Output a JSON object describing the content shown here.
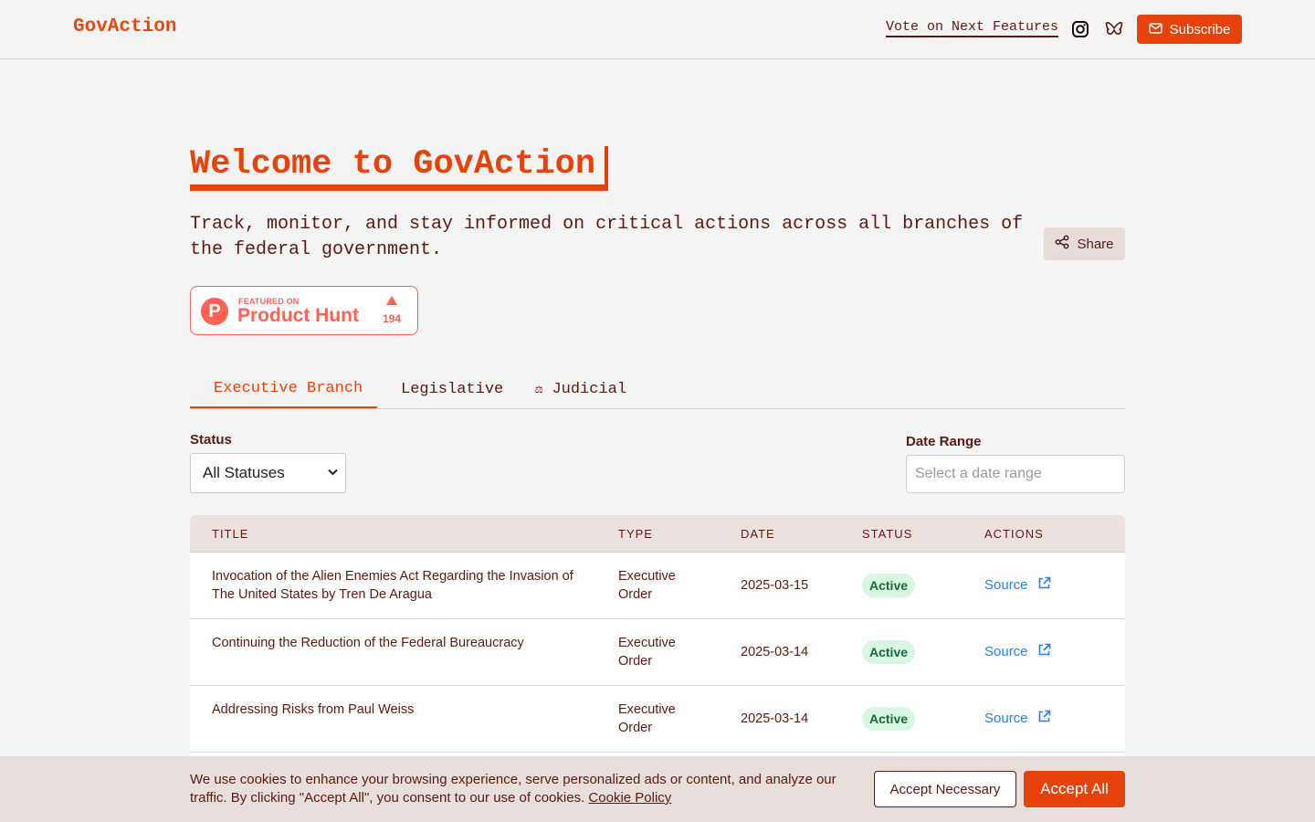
{
  "header": {
    "logo": "GovAction",
    "vote_link": "Vote on Next Features",
    "instagram_icon": "instagram-icon",
    "bluesky_icon": "bluesky-icon",
    "subscribe_label": "Subscribe",
    "accent": "#e8420c"
  },
  "hero": {
    "title": "Welcome to GovAction",
    "subtitle": "Track, monitor, and stay informed on critical actions across all branches of the federal government.",
    "share_label": "Share"
  },
  "product_hunt": {
    "featured_label": "FEATURED ON",
    "name": "Product Hunt",
    "logo_letter": "P",
    "upvotes": "194"
  },
  "tabs": [
    {
      "label": "Executive Branch",
      "icon": "building-icon",
      "glyph": "",
      "active": true
    },
    {
      "label": "Legislative",
      "icon": "capitol-icon",
      "glyph": "",
      "active": false
    },
    {
      "label": "Judicial",
      "icon": "scales-icon",
      "glyph": "⚖",
      "active": false
    }
  ],
  "filters": {
    "status_label": "Status",
    "status_value": "All Statuses",
    "date_label": "Date Range",
    "date_placeholder": "Select a date range"
  },
  "table": {
    "columns": [
      "TITLE",
      "TYPE",
      "DATE",
      "STATUS",
      "ACTIONS"
    ],
    "rows": [
      {
        "title": "Invocation of the Alien Enemies Act Regarding the Invasion of The United States by Tren De Aragua",
        "type": "Executive Order",
        "date": "2025-03-15",
        "status": "Active",
        "action": "Source"
      },
      {
        "title": "Continuing the Reduction of the Federal Bureaucracy",
        "type": "Executive Order",
        "date": "2025-03-14",
        "status": "Active",
        "action": "Source"
      },
      {
        "title": "Addressing Risks from Paul Weiss",
        "type": "Executive Order",
        "date": "2025-03-14",
        "status": "Active",
        "action": "Source"
      }
    ]
  },
  "cookie": {
    "text": "We use cookies to enhance your browsing experience, serve personalized ads or content, and analyze our traffic. By clicking \"Accept All\", you consent to our use of cookies.",
    "policy_link": "Cookie Policy",
    "accept_necessary": "Accept Necessary",
    "accept_all": "Accept All"
  }
}
